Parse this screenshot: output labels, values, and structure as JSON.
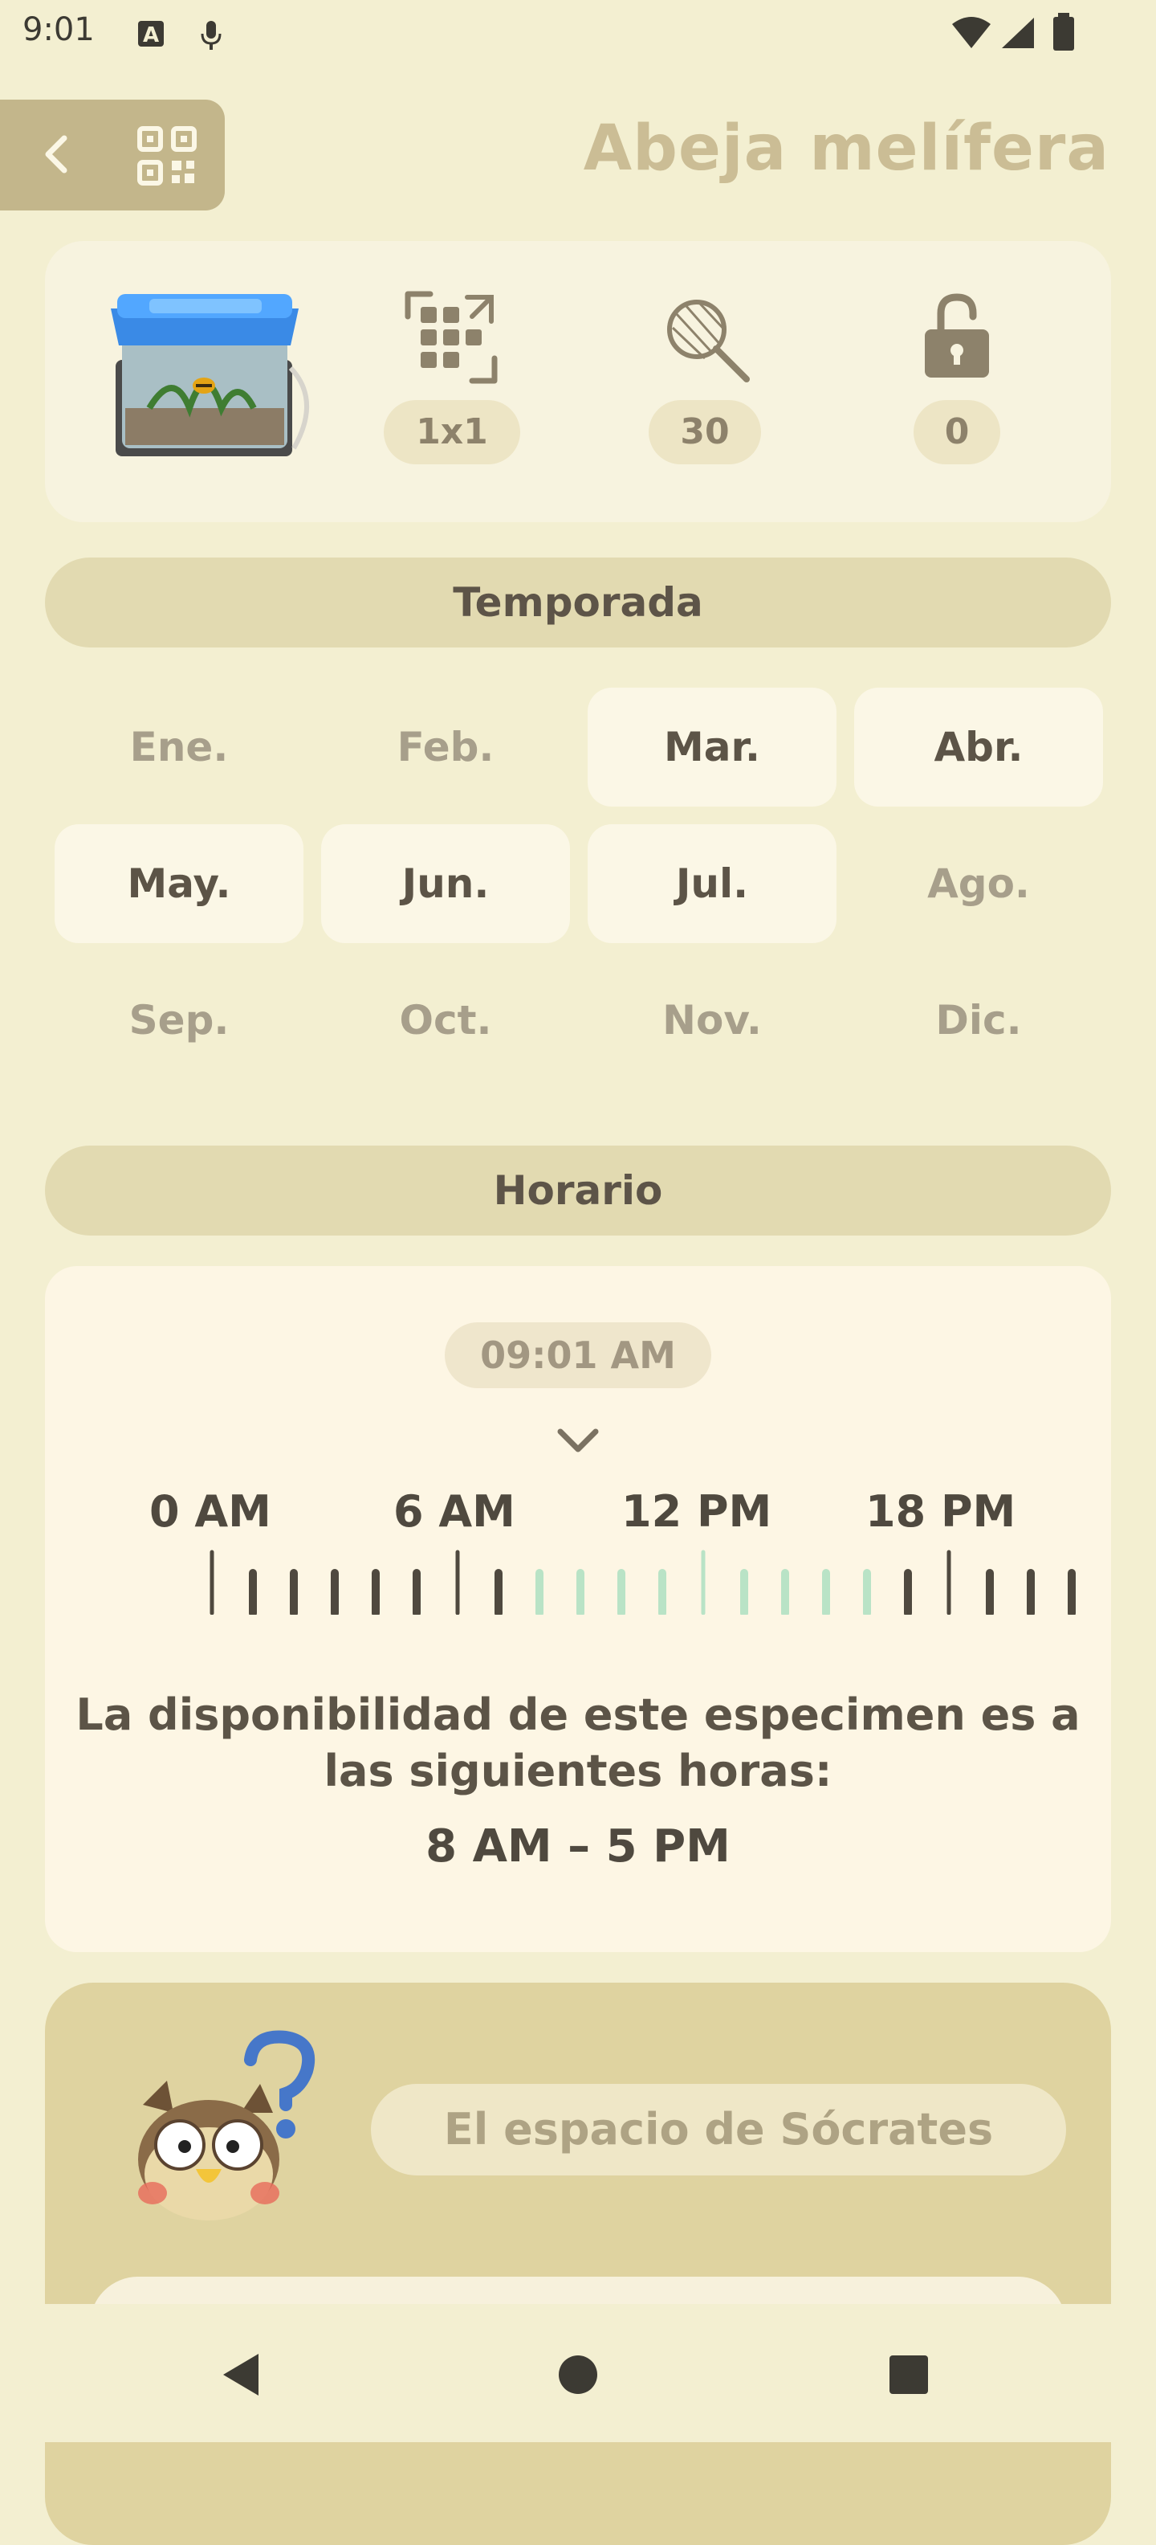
{
  "status_bar": {
    "time": "9:01",
    "icons": [
      "keyboard-a-icon",
      "mic-icon",
      "wifi-icon",
      "signal-icon",
      "battery-icon"
    ]
  },
  "header": {
    "title": "Abeja melífera",
    "back_icon": "chevron-left-icon",
    "qr_icon": "qr-code-icon"
  },
  "info": {
    "item_image": "bug-cage-bee-image",
    "size": "1x1",
    "catch_count": "30",
    "unlock_count": "0",
    "icons": [
      "resize-grid-icon",
      "bug-net-icon",
      "unlock-icon"
    ]
  },
  "season": {
    "header": "Temporada",
    "months": [
      {
        "label": "Ene.",
        "available": false
      },
      {
        "label": "Feb.",
        "available": false
      },
      {
        "label": "Mar.",
        "available": true
      },
      {
        "label": "Abr.",
        "available": true
      },
      {
        "label": "May.",
        "available": true
      },
      {
        "label": "Jun.",
        "available": true
      },
      {
        "label": "Jul.",
        "available": true
      },
      {
        "label": "Ago.",
        "available": false
      },
      {
        "label": "Sep.",
        "available": false
      },
      {
        "label": "Oct.",
        "available": false
      },
      {
        "label": "Nov.",
        "available": false
      },
      {
        "label": "Dic.",
        "available": false
      }
    ]
  },
  "schedule": {
    "header": "Horario",
    "current_time": "09:01 AM",
    "tick_labels": [
      "0 AM",
      "6 AM",
      "12 PM",
      "18 PM"
    ],
    "available_hours": [
      8,
      9,
      10,
      11,
      12,
      13,
      14,
      15,
      16
    ],
    "availability_text": "La disponibilidad de este especimen es a las siguientes horas:",
    "availability_hours_text": "8 AM – 5 PM"
  },
  "museum": {
    "button_label": "El espacio de Sócrates",
    "avatar": "blathers-owl-icon"
  },
  "nav_bar": {
    "icons": [
      "nav-back-icon",
      "nav-home-icon",
      "nav-recents-icon"
    ]
  },
  "colors": {
    "background": "#f3efd1",
    "accent": "#c3b68b",
    "available_tick": "#b9e3c6",
    "unavailable_tick": "#4f493f"
  }
}
